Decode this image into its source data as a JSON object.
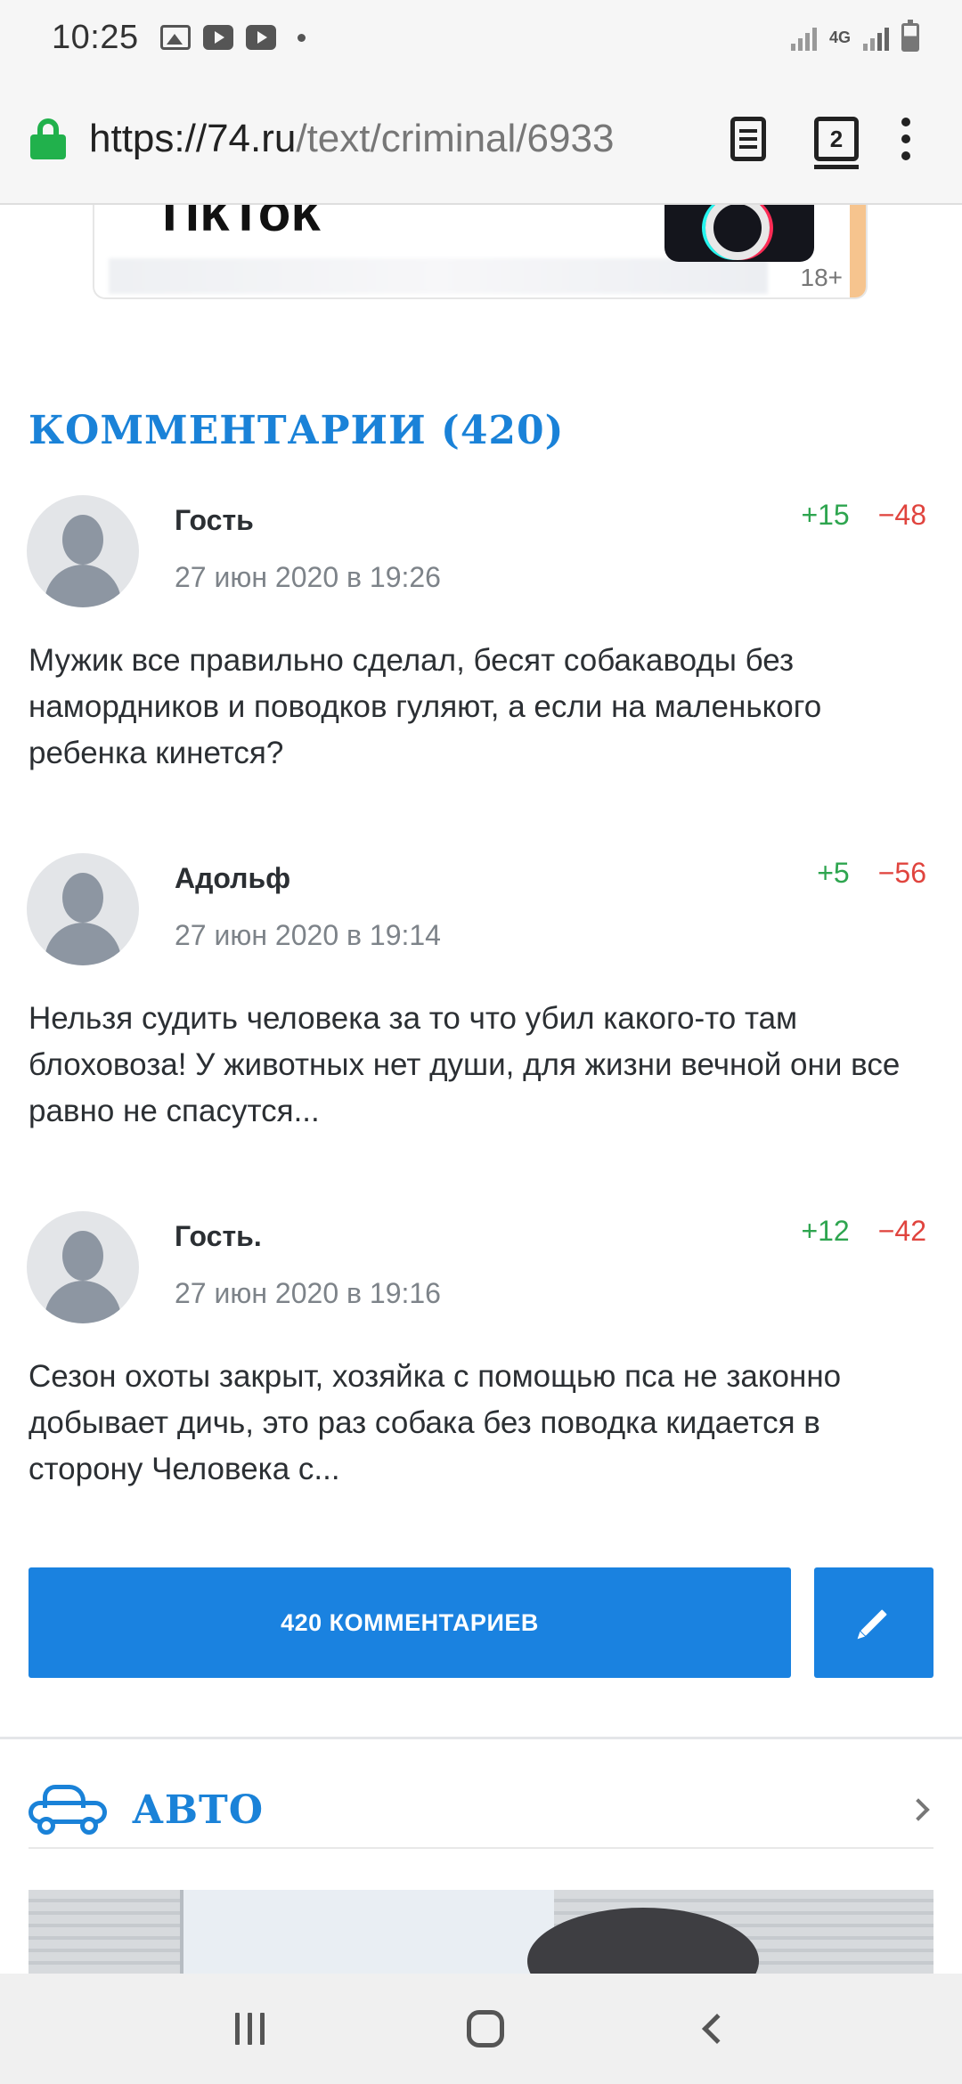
{
  "status_bar": {
    "time": "10:25",
    "icons": [
      "image-icon",
      "youtube-icon",
      "youtube-icon",
      "dot-icon"
    ],
    "network": "4G",
    "right_icons": [
      "signal-icon",
      "signal-icon",
      "battery-icon"
    ]
  },
  "browser": {
    "url_host": "https://74.ru",
    "url_path": "/text/criminal/6933",
    "tab_count": "2"
  },
  "ad": {
    "title": "TikTok",
    "age_rating": "18+"
  },
  "comments_section": {
    "title": "КОММЕНТАРИИ (420)",
    "items": [
      {
        "author": "Гость",
        "date": "27 июн 2020 в 19:26",
        "votes_up": "+15",
        "votes_down": "−48",
        "text": "Мужик все правильно сделал, бесят собакаводы без намордников и поводков гуляют, а если на маленького ребенка кинется?"
      },
      {
        "author": "Адольф",
        "date": "27 июн 2020 в 19:14",
        "votes_up": "+5",
        "votes_down": "−56",
        "text": "Нельзя судить человека за то что убил какого-то там блоховоза! У животных нет души, для жизни вечной они все равно не спасутся..."
      },
      {
        "author": "Гость.",
        "date": "27 июн 2020 в 19:16",
        "votes_up": "+12",
        "votes_down": "−42",
        "text": "Сезон охоты закрыт, хозяйка с помощью пса не законно добывает дичь, это раз собака без поводка кидается в сторону Человека с..."
      }
    ],
    "all_comments_label": "420 КОММЕНТАРИЕВ"
  },
  "auto_section": {
    "title": "АВТО"
  },
  "colors": {
    "accent": "#1a82e0",
    "vote_up": "#2ea54f",
    "vote_down": "#e0443e"
  }
}
